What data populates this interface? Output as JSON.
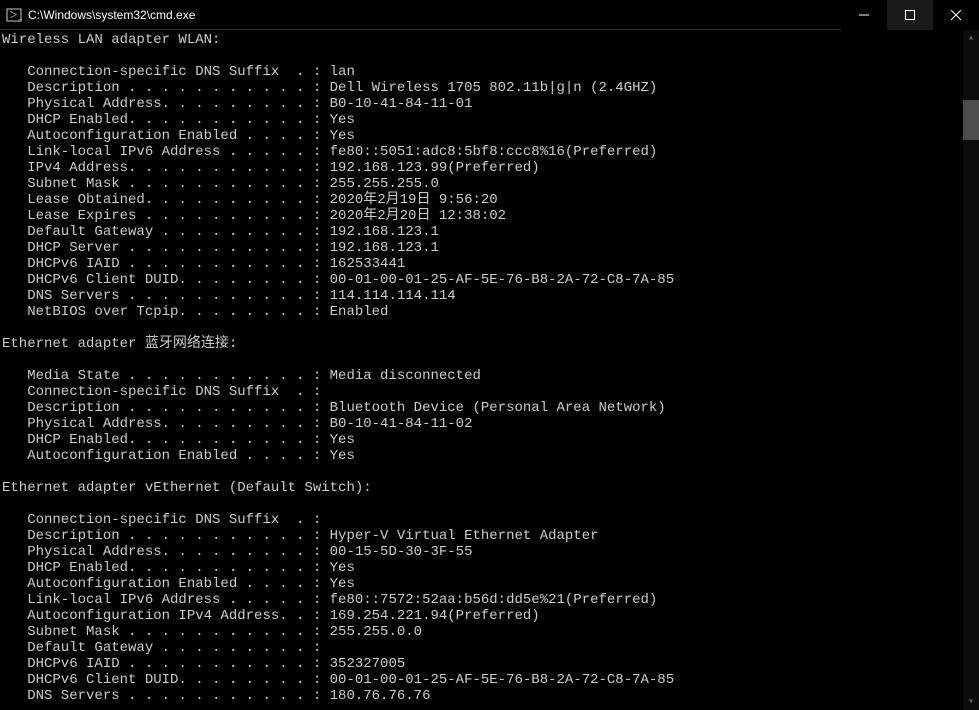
{
  "window": {
    "title": "C:\\Windows\\system32\\cmd.exe"
  },
  "adapters": [
    {
      "header": "Wireless LAN adapter WLAN:",
      "rows": [
        {
          "label": "Connection-specific DNS Suffix  .",
          "value": "lan"
        },
        {
          "label": "Description . . . . . . . . . . .",
          "value": "Dell Wireless 1705 802.11b|g|n (2.4GHZ)"
        },
        {
          "label": "Physical Address. . . . . . . . .",
          "value": "B0-10-41-84-11-01"
        },
        {
          "label": "DHCP Enabled. . . . . . . . . . .",
          "value": "Yes"
        },
        {
          "label": "Autoconfiguration Enabled . . . .",
          "value": "Yes"
        },
        {
          "label": "Link-local IPv6 Address . . . . .",
          "value": "fe80::5051:adc8:5bf8:ccc8%16(Preferred)"
        },
        {
          "label": "IPv4 Address. . . . . . . . . . .",
          "value": "192.168.123.99(Preferred)"
        },
        {
          "label": "Subnet Mask . . . . . . . . . . .",
          "value": "255.255.255.0"
        },
        {
          "label": "Lease Obtained. . . . . . . . . .",
          "value": "2020年2月19日 9:56:20"
        },
        {
          "label": "Lease Expires . . . . . . . . . .",
          "value": "2020年2月20日 12:38:02"
        },
        {
          "label": "Default Gateway . . . . . . . . .",
          "value": "192.168.123.1"
        },
        {
          "label": "DHCP Server . . . . . . . . . . .",
          "value": "192.168.123.1"
        },
        {
          "label": "DHCPv6 IAID . . . . . . . . . . .",
          "value": "162533441"
        },
        {
          "label": "DHCPv6 Client DUID. . . . . . . .",
          "value": "00-01-00-01-25-AF-5E-76-B8-2A-72-C8-7A-85"
        },
        {
          "label": "DNS Servers . . . . . . . . . . .",
          "value": "114.114.114.114"
        },
        {
          "label": "NetBIOS over Tcpip. . . . . . . .",
          "value": "Enabled"
        }
      ]
    },
    {
      "header": "Ethernet adapter 蓝牙网络连接:",
      "rows": [
        {
          "label": "Media State . . . . . . . . . . .",
          "value": "Media disconnected"
        },
        {
          "label": "Connection-specific DNS Suffix  .",
          "value": ""
        },
        {
          "label": "Description . . . . . . . . . . .",
          "value": "Bluetooth Device (Personal Area Network)"
        },
        {
          "label": "Physical Address. . . . . . . . .",
          "value": "B0-10-41-84-11-02"
        },
        {
          "label": "DHCP Enabled. . . . . . . . . . .",
          "value": "Yes"
        },
        {
          "label": "Autoconfiguration Enabled . . . .",
          "value": "Yes"
        }
      ]
    },
    {
      "header": "Ethernet adapter vEthernet (Default Switch):",
      "rows": [
        {
          "label": "Connection-specific DNS Suffix  .",
          "value": ""
        },
        {
          "label": "Description . . . . . . . . . . .",
          "value": "Hyper-V Virtual Ethernet Adapter"
        },
        {
          "label": "Physical Address. . . . . . . . .",
          "value": "00-15-5D-30-3F-55"
        },
        {
          "label": "DHCP Enabled. . . . . . . . . . .",
          "value": "Yes"
        },
        {
          "label": "Autoconfiguration Enabled . . . .",
          "value": "Yes"
        },
        {
          "label": "Link-local IPv6 Address . . . . .",
          "value": "fe80::7572:52aa:b56d:dd5e%21(Preferred)"
        },
        {
          "label": "Autoconfiguration IPv4 Address. .",
          "value": "169.254.221.94(Preferred)"
        },
        {
          "label": "Subnet Mask . . . . . . . . . . .",
          "value": "255.255.0.0"
        },
        {
          "label": "Default Gateway . . . . . . . . .",
          "value": ""
        },
        {
          "label": "DHCPv6 IAID . . . . . . . . . . .",
          "value": "352327005"
        },
        {
          "label": "DHCPv6 Client DUID. . . . . . . .",
          "value": "00-01-00-01-25-AF-5E-76-B8-2A-72-C8-7A-85"
        },
        {
          "label": "DNS Servers . . . . . . . . . . .",
          "value": "180.76.76.76"
        }
      ]
    }
  ]
}
